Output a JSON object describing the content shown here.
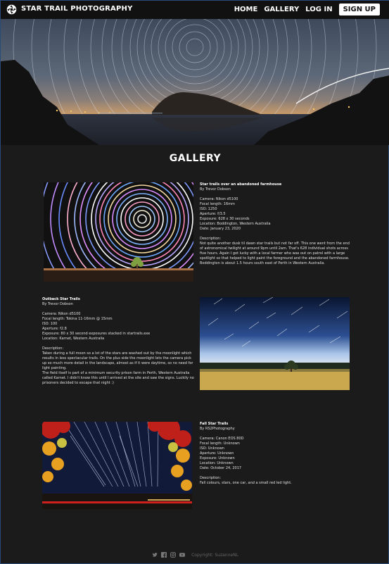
{
  "nav": {
    "logo_icon": "camera-aperture-icon",
    "brand": "STAR TRAIL PHOTOGRAPHY",
    "links": [
      "HOME",
      "GALLERY",
      "LOG IN"
    ],
    "signup": "SIGN UP"
  },
  "hero": {
    "alt": "star-trails-over-lake-hero-image"
  },
  "gallery": {
    "title": "GALLERY",
    "entries": [
      {
        "title": "Star trails over an abandoned farmhouse",
        "author": "By Trevor Dobson",
        "specs": [
          "Camera: Nikon d5100",
          "Focal length: 16mm",
          "ISO: 1250",
          "Aperture: f/3.5",
          "Exposure: 628 x 30 seconds",
          "Location: Boddington, Western Australia",
          "Date: January 23, 2020"
        ],
        "description_label": "Description:",
        "description": [
          "Not quite another dusk til dawn star trails but not far off. This one went from the end of astronomical twilight at around 9pm until 2am. That's 628 individual shots across five hours. Again I got lucky with a local farmer who was out on patrol with a large spotlight so that helped to light paint the foreground and the abandoned farmhouse. Boddington is about 1.5 hours south east of Perth in Western Australia."
        ]
      },
      {
        "title": "Outback Star Trails",
        "author": "By Trevor Dobson",
        "specs": [
          "Camera: Nikon d5100",
          "Focal length: Tokina 11-16mm @ 15mm",
          "ISO: 100",
          "Aperture: f2.8",
          "Exposure: 80 x 30 second exposures stacked in startrails.exe",
          "Location: Karnet, Western Australia"
        ],
        "description_label": "Description:",
        "description": [
          "Taken during a full moon so a lot of the stars are washed out by the moonlight which results in less spectacular trails. On the plus side the moonlight lets the camera pick up so much more detail in the landscape, almost as if it were daytime, so no need for light painting.",
          "The field itself is part of a minimum security prison farm in Perth, Western Australia called Karnet. I didn't know this until I arrived at the site and saw the signs. Luckily no prisoners decided to escape that night :)"
        ]
      },
      {
        "title": "Fall Star Trails",
        "author": "By RS2Photography",
        "specs": [
          "Camera: Canon EOS 80D",
          "Focal length: Unknown",
          "ISO: Unknown",
          "Aperture: Unknown",
          "Exposure: Unknown",
          "Location: Unknown",
          "Date: October 24, 2017"
        ],
        "description_label": "Description:",
        "description": [
          "Fall colours, stars, one car, and a small red led light."
        ]
      }
    ]
  },
  "footer": {
    "icons": [
      "twitter-icon",
      "facebook-icon",
      "instagram-icon",
      "youtube-icon"
    ],
    "copyright": "Copyright: SuzanneNL"
  },
  "colors": {
    "background": "#1b1b1b",
    "nav": "#111111",
    "accent_border": "#2a4a78"
  }
}
